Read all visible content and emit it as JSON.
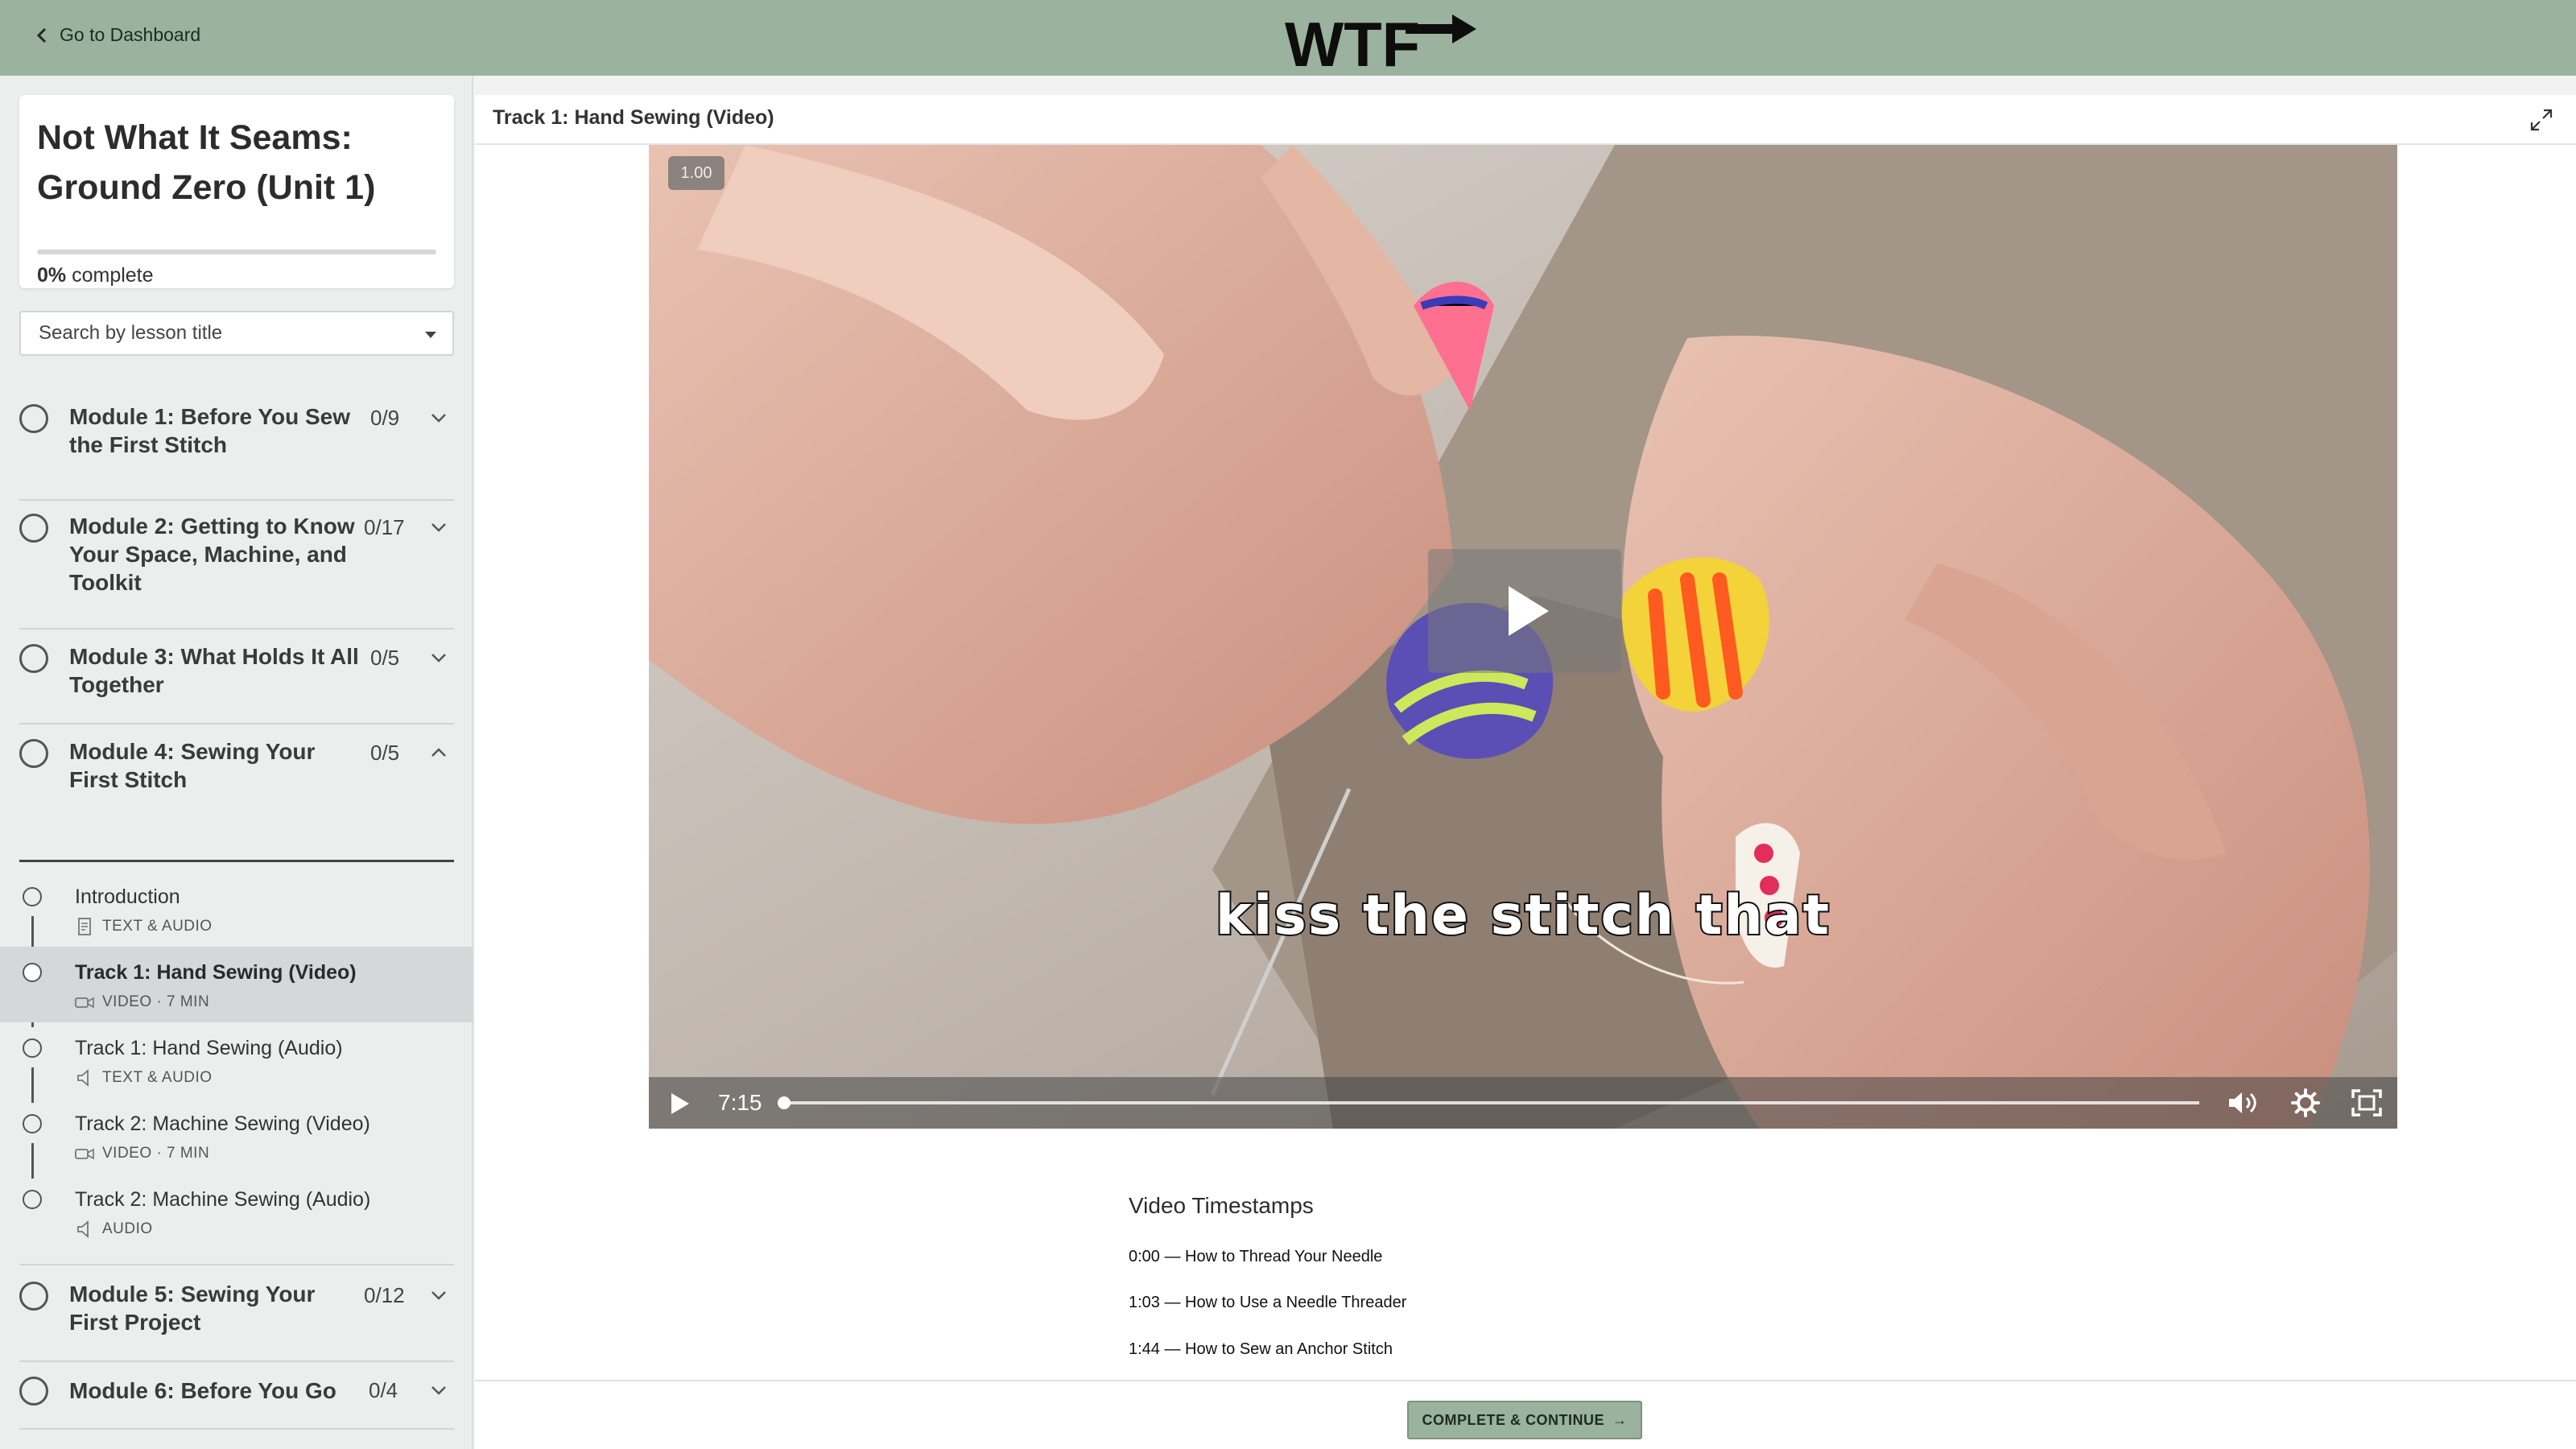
{
  "topbar": {
    "back_label": "Go to Dashboard",
    "logo_text": "WTF",
    "back_icon": "chevron-left-icon",
    "logo_icon": "arrow-right-icon"
  },
  "course": {
    "title": "Not What It Seams: Ground Zero (Unit 1)",
    "progress_percent": "0%",
    "progress_suffix": "complete",
    "progress_value": 0
  },
  "search": {
    "placeholder": "Search by lesson title"
  },
  "modules": [
    {
      "title": "Module 1: Before You Sew the First Stitch",
      "count": "0/9",
      "expanded": false
    },
    {
      "title": "Module 2: Getting to Know Your Space, Machine, and Toolkit",
      "count": "0/17",
      "expanded": false
    },
    {
      "title": "Module 3: What Holds It All Together",
      "count": "0/5",
      "expanded": false
    },
    {
      "title": "Module 4: Sewing Your First Stitch",
      "count": "0/5",
      "expanded": true
    },
    {
      "title": "Module 5: Sewing Your First Project",
      "count": "0/12",
      "expanded": false
    },
    {
      "title": "Module 6: Before You Go",
      "count": "0/4",
      "expanded": false
    }
  ],
  "lessons": [
    {
      "title": "Introduction",
      "meta": "TEXT & AUDIO",
      "icon": "document-icon",
      "active": false
    },
    {
      "title": "Track 1: Hand Sewing (Video)",
      "meta": "VIDEO · 7 MIN",
      "icon": "video-camera-icon",
      "active": true
    },
    {
      "title": "Track 1: Hand Sewing (Audio)",
      "meta": "TEXT & AUDIO",
      "icon": "speaker-icon",
      "active": false
    },
    {
      "title": "Track 2: Machine Sewing (Video)",
      "meta": "VIDEO · 7 MIN",
      "icon": "video-camera-icon",
      "active": false
    },
    {
      "title": "Track 2: Machine Sewing (Audio)",
      "meta": "AUDIO",
      "icon": "speaker-icon",
      "active": false
    }
  ],
  "main": {
    "title": "Track 1: Hand Sewing (Video)",
    "expand_icon": "expand-icon"
  },
  "video": {
    "speed": "1.00",
    "caption": "kiss the stitch that",
    "duration": "7:15",
    "progress_fraction": 0
  },
  "timestamps": {
    "title": "Video Timestamps",
    "items": [
      "0:00 — How to Thread Your Needle",
      "1:03 — How to Use a Needle Threader",
      "1:44 — How to Sew an Anchor Stitch"
    ]
  },
  "footer": {
    "continue_label": "COMPLETE & CONTINUE",
    "continue_arrow": "→"
  },
  "colors": {
    "accent": "#9bb29e",
    "sidebar_bg": "#eceded",
    "active_lesson_bg": "#d6d7d9"
  }
}
